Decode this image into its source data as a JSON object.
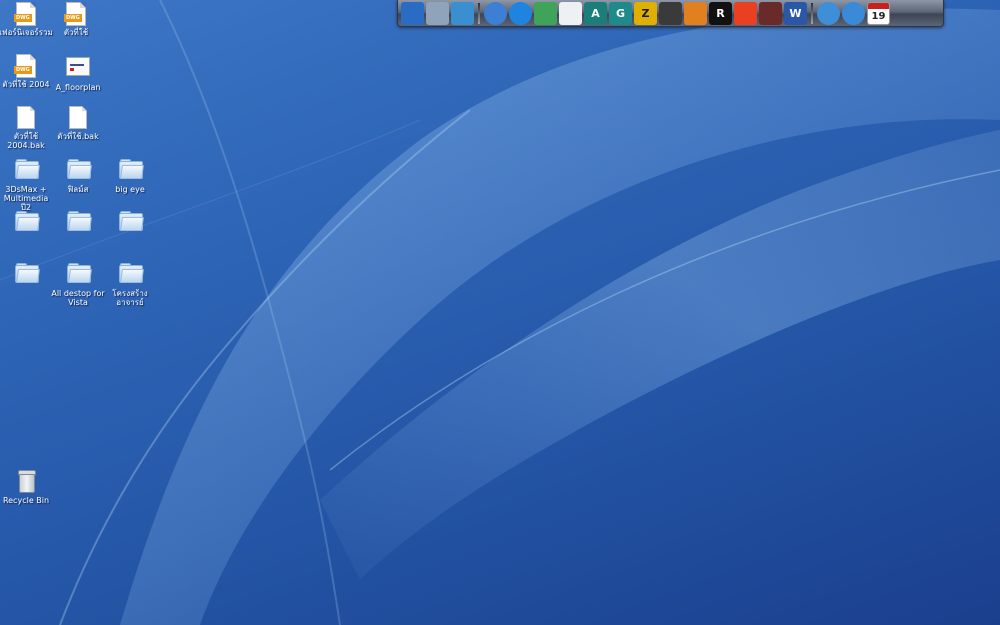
{
  "desktop": {
    "icons": [
      {
        "label": "เฟอร์นิเจอร์รวม",
        "type": "dwg"
      },
      {
        "label": "ตัวที่ใช้",
        "type": "dwg"
      },
      {
        "label": "ตัวที่ใช้ 2004",
        "type": "dwg"
      },
      {
        "label": "A_floorplan",
        "type": "shortcut"
      },
      {
        "label": "ตัวที่ใช้ 2004.bak",
        "type": "file"
      },
      {
        "label": "ตัวที่ใช้.bak",
        "type": "file"
      },
      {
        "label": "3DsMax + Multimedia ปี2",
        "type": "folder"
      },
      {
        "label": "ฟิลม์ส",
        "type": "folder"
      },
      {
        "label": "big eye",
        "type": "folder"
      },
      {
        "label": "",
        "type": "folder"
      },
      {
        "label": "",
        "type": "folder"
      },
      {
        "label": "",
        "type": "folder"
      },
      {
        "label": "",
        "type": "folder"
      },
      {
        "label": "All destop for Vista",
        "type": "folder"
      },
      {
        "label": "โครงสร้าง อาจารย์",
        "type": "folder"
      },
      {
        "label": "Recycle Bin",
        "type": "recycle-bin"
      }
    ],
    "dwg_tag": "DWG"
  },
  "dock": {
    "items": [
      {
        "icon": "network-icon",
        "color": "#2a6cc4"
      },
      {
        "icon": "finder-icon",
        "color": "#8fa3bb"
      },
      {
        "icon": "3d-model-icon",
        "color": "#3a8fd0"
      },
      {
        "icon": "separator"
      },
      {
        "icon": "globe-icon",
        "color": "#3c7fd4"
      },
      {
        "icon": "media-player-icon",
        "color": "#1f84e0"
      },
      {
        "icon": "messenger-icon",
        "color": "#3fa35a"
      },
      {
        "icon": "feather-icon",
        "color": "#eef1f4"
      },
      {
        "icon": "autocad-icon",
        "color": "#1a7f7a",
        "text": "A"
      },
      {
        "icon": "3dsmax-icon",
        "color": "#1e8a8a",
        "text": "G"
      },
      {
        "icon": "zbrush-icon",
        "color": "#e0b000",
        "text": "Z"
      },
      {
        "icon": "game-icon",
        "color": "#3a3a3a"
      },
      {
        "icon": "flower-icon",
        "color": "#e08020"
      },
      {
        "icon": "rockstar-icon",
        "color": "#111111",
        "text": "R"
      },
      {
        "icon": "photo-app-icon",
        "color": "#e84020"
      },
      {
        "icon": "clapper-icon",
        "color": "#6a2a2a"
      },
      {
        "icon": "word-icon",
        "color": "#2a57a8",
        "text": "W"
      },
      {
        "icon": "separator"
      },
      {
        "icon": "search-icon",
        "color": "#3f8fd8"
      },
      {
        "icon": "internet-explorer-icon",
        "color": "#3b8ad8"
      },
      {
        "icon": "calendar-icon",
        "color": "#ffffff",
        "text": "19"
      }
    ]
  }
}
